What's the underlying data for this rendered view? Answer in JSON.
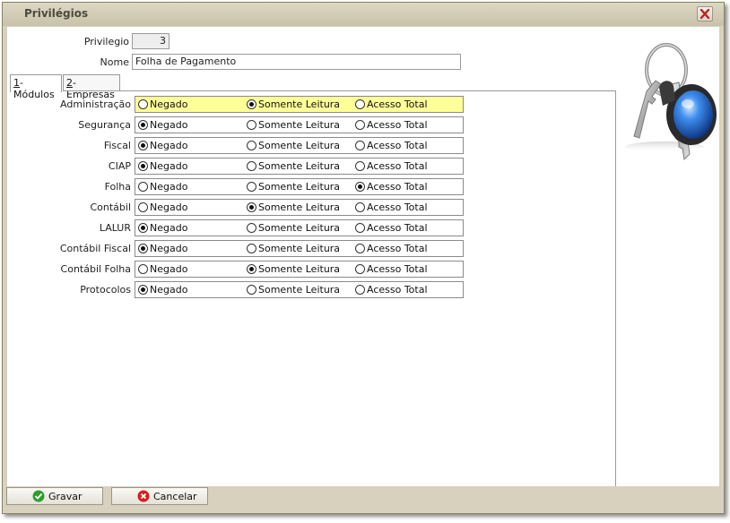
{
  "window": {
    "title": "Privilégios",
    "close_symbol": "✕"
  },
  "form": {
    "privilegio": {
      "label": "Privilegio",
      "value": "3"
    },
    "nome": {
      "label": "Nome",
      "value": "Folha de Pagamento"
    }
  },
  "tabs": [
    {
      "key": "1",
      "rest": "-Módulos",
      "active": true
    },
    {
      "key": "2",
      "rest": "-Empresas",
      "active": false
    }
  ],
  "options": [
    "Negado",
    "Somente Leitura",
    "Acesso Total"
  ],
  "modules": [
    {
      "label": "Administração",
      "selected": 1,
      "highlight": true
    },
    {
      "label": "Segurança",
      "selected": 0,
      "highlight": false
    },
    {
      "label": "Fiscal",
      "selected": 0,
      "highlight": false
    },
    {
      "label": "CIAP",
      "selected": 0,
      "highlight": false
    },
    {
      "label": "Folha",
      "selected": 2,
      "highlight": false
    },
    {
      "label": "Contábil",
      "selected": 1,
      "highlight": false
    },
    {
      "label": "LALUR",
      "selected": 0,
      "highlight": false
    },
    {
      "label": "Contábil Fiscal",
      "selected": 0,
      "highlight": false
    },
    {
      "label": "Contábil Folha",
      "selected": 1,
      "highlight": false
    },
    {
      "label": "Protocolos",
      "selected": 0,
      "highlight": false
    }
  ],
  "buttons": {
    "gravar": "Gravar",
    "cancelar": "Cancelar"
  },
  "icons": {
    "close": "close-icon",
    "keys": "keys-icon",
    "save": "check-icon",
    "cancel": "cancel-icon"
  },
  "colors": {
    "highlight_row": "#ffff99",
    "title_bar": "#d4cdb7",
    "save_icon": "#2e9e2e",
    "cancel_icon": "#d42020"
  }
}
